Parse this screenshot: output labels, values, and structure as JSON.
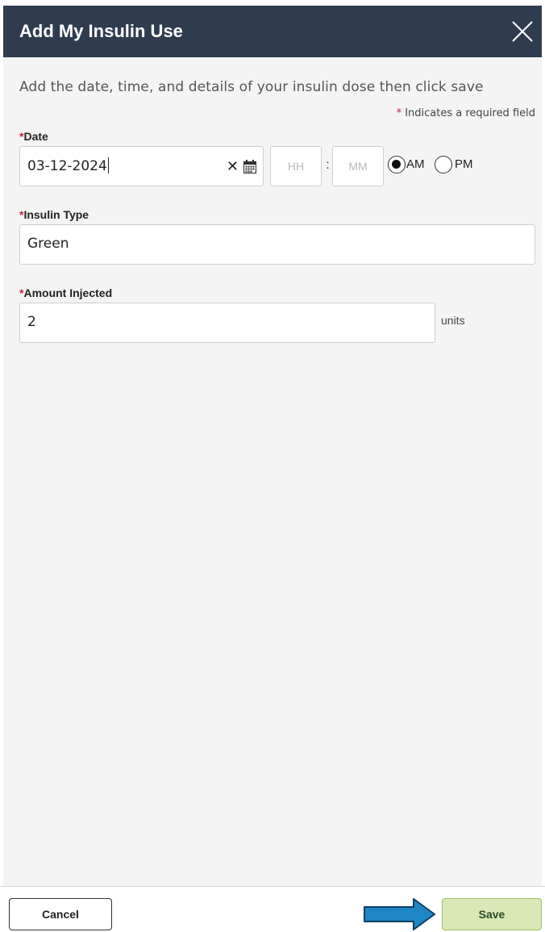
{
  "modal": {
    "title": "Add My Insulin Use"
  },
  "form": {
    "intro": "Add the date, time, and details of your insulin dose then click save",
    "required_note_star": "*",
    "required_note": " Indicates a required field",
    "date": {
      "star": "*",
      "label": "Date",
      "value": "03-12-2024",
      "clear_symbol": "✕"
    },
    "time": {
      "hour_placeholder": "HH",
      "separator": ":",
      "minute_placeholder": "MM",
      "am_label": "AM",
      "pm_label": "PM",
      "selected": "AM"
    },
    "insulin_type": {
      "star": "*",
      "label": "Insulin Type",
      "value": "Green"
    },
    "amount": {
      "star": "*",
      "label": "Amount Injected",
      "value": "2",
      "unit": "units"
    }
  },
  "footer": {
    "cancel_label": "Cancel",
    "save_label": "Save"
  },
  "colors": {
    "header_bg": "#2f3c50",
    "required_star": "#c8203a",
    "save_bg": "#d8e8b6",
    "arrow": "#1f86c4"
  },
  "icons": [
    "close-icon",
    "clear-icon",
    "calendar-icon",
    "arrow-right-icon"
  ]
}
